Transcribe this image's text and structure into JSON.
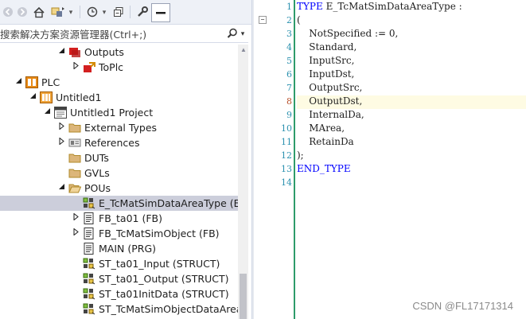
{
  "toolbar": {
    "buttons": [
      "back",
      "forward",
      "home",
      "sync-view",
      "dropdown",
      "history",
      "collapse-all",
      "properties",
      "preview"
    ]
  },
  "search": {
    "placeholder": "搜索解决方案资源管理器(Ctrl+;)",
    "search_icon": "magnifier-icon",
    "dropdown_glyph": "▾"
  },
  "tree": [
    {
      "label": "Outputs",
      "icon": "outputs-icon",
      "expanded": true,
      "indent": 4
    },
    {
      "label": "ToPlc",
      "icon": "toplc-icon",
      "expanded": false,
      "indent": 5
    },
    {
      "label": "PLC",
      "icon": "plc-icon",
      "expanded": true,
      "indent": 1
    },
    {
      "label": "Untitled1",
      "icon": "plc-project-icon",
      "expanded": true,
      "indent": 2
    },
    {
      "label": "Untitled1 Project",
      "icon": "project-icon",
      "expanded": true,
      "indent": 3
    },
    {
      "label": "External Types",
      "icon": "folder-icon",
      "expanded": false,
      "indent": 4
    },
    {
      "label": "References",
      "icon": "references-icon",
      "expanded": false,
      "indent": 4
    },
    {
      "label": "DUTs",
      "icon": "folder-icon",
      "expanded": null,
      "indent": 4
    },
    {
      "label": "GVLs",
      "icon": "folder-icon",
      "expanded": null,
      "indent": 4
    },
    {
      "label": "POUs",
      "icon": "folder-open-icon",
      "expanded": true,
      "indent": 4
    },
    {
      "label": "E_TcMatSimDataAreaType (E",
      "icon": "dut-icon",
      "expanded": null,
      "indent": 5,
      "selected": true
    },
    {
      "label": "FB_ta01 (FB)",
      "icon": "pou-icon",
      "expanded": false,
      "indent": 5
    },
    {
      "label": "FB_TcMatSimObject (FB)",
      "icon": "pou-icon",
      "expanded": false,
      "indent": 5
    },
    {
      "label": "MAIN (PRG)",
      "icon": "pou-icon",
      "expanded": null,
      "indent": 5
    },
    {
      "label": "ST_ta01_Input (STRUCT)",
      "icon": "dut-icon",
      "expanded": null,
      "indent": 5
    },
    {
      "label": "ST_ta01_Output (STRUCT)",
      "icon": "dut-icon",
      "expanded": null,
      "indent": 5
    },
    {
      "label": "ST_ta01InitData (STRUCT)",
      "icon": "dut-icon",
      "expanded": null,
      "indent": 5
    },
    {
      "label": "ST_TcMatSimObjectDataArea",
      "icon": "dut-icon",
      "expanded": null,
      "indent": 5
    }
  ],
  "editor": {
    "lines": [
      {
        "n": "1",
        "parts": [
          [
            "kw",
            "TYPE "
          ],
          [
            "",
            "E_TcMatSimDataAreaType :"
          ]
        ]
      },
      {
        "n": "2",
        "parts": [
          [
            "",
            "("
          ]
        ]
      },
      {
        "n": "3",
        "parts": [
          [
            "",
            "    NotSpecified := "
          ],
          [
            "num",
            "0"
          ],
          [
            "",
            ","
          ]
        ]
      },
      {
        "n": "4",
        "parts": [
          [
            "",
            "    Standard,"
          ]
        ]
      },
      {
        "n": "5",
        "parts": [
          [
            "",
            "    InputSrc,"
          ]
        ]
      },
      {
        "n": "6",
        "parts": [
          [
            "",
            "    InputDst,"
          ]
        ]
      },
      {
        "n": "7",
        "parts": [
          [
            "",
            "    OutputSrc,"
          ]
        ]
      },
      {
        "n": "8",
        "parts": [
          [
            "",
            "    OutputDst,"
          ]
        ],
        "highlight": true
      },
      {
        "n": "9",
        "parts": [
          [
            "",
            "    InternalDa,"
          ]
        ]
      },
      {
        "n": "10",
        "parts": [
          [
            "",
            "    MArea,"
          ]
        ]
      },
      {
        "n": "11",
        "parts": [
          [
            "",
            "    RetainDa"
          ]
        ]
      },
      {
        "n": "12",
        "parts": [
          [
            "",
            ");"
          ]
        ]
      },
      {
        "n": "13",
        "parts": [
          [
            "kw",
            "END_TYPE"
          ]
        ]
      },
      {
        "n": "14",
        "parts": []
      }
    ],
    "fold_glyph": "−"
  },
  "watermark": "CSDN @FL17171314",
  "colors": {
    "keyword": "#0000ff",
    "line_number": "#2b91af",
    "selection": "#cccedb",
    "current_line": "#fefbe3",
    "change_bar": "#2e9c6a"
  }
}
